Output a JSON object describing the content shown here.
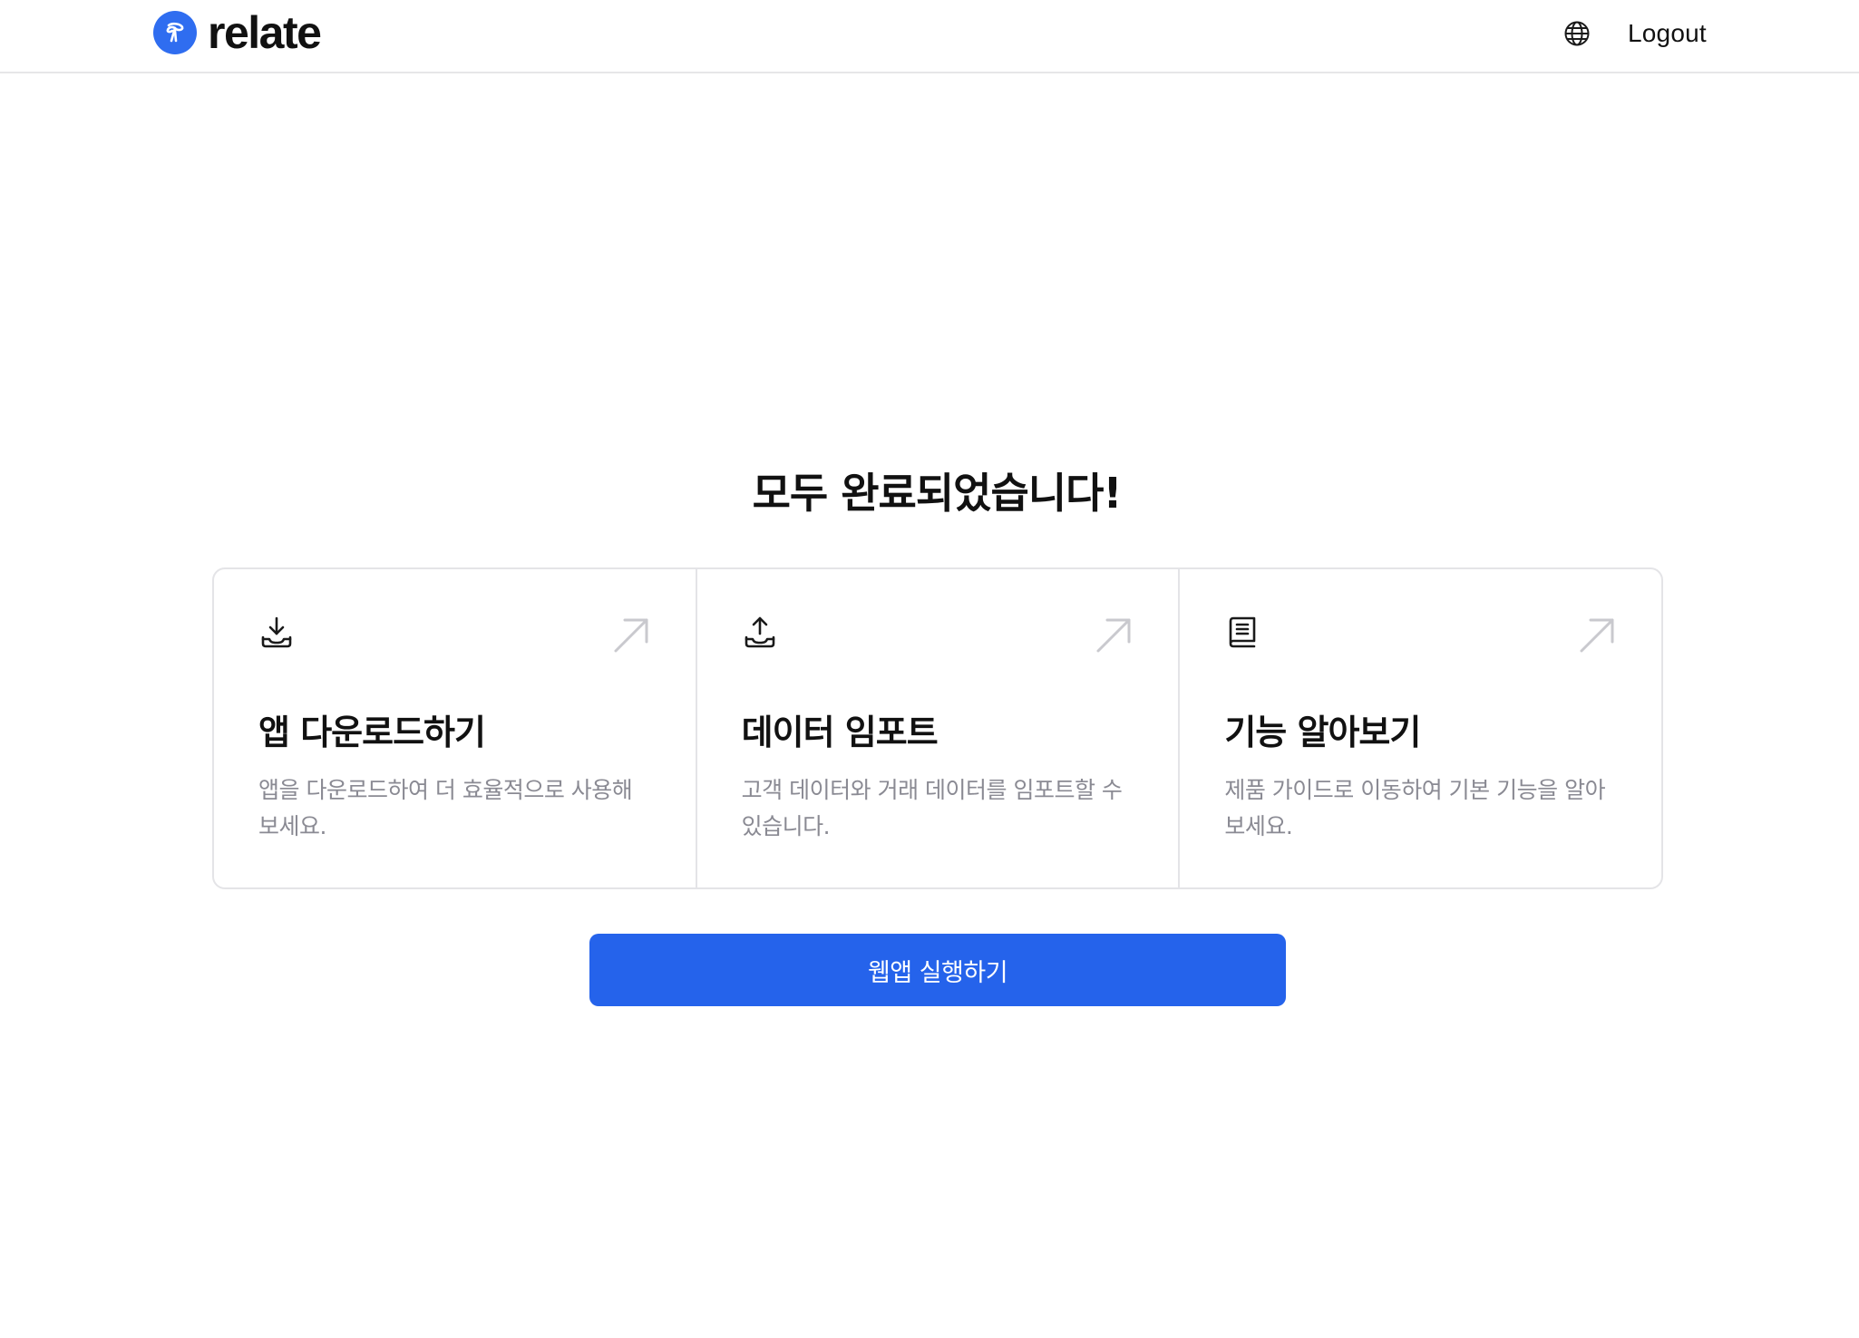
{
  "header": {
    "logo_text": "relate",
    "logout_label": "Logout",
    "icons": {
      "logo": "relate-logo-icon",
      "language": "globe-icon"
    },
    "brand_color": "#2f6df0"
  },
  "main": {
    "title": "모두 완료되었습니다!",
    "cards": [
      {
        "icon": "download-icon",
        "title": "앱 다운로드하기",
        "description": "앱을 다운로드하여 더 효율적으로 사용해보세요."
      },
      {
        "icon": "upload-icon",
        "title": "데이터 임포트",
        "description": "고객 데이터와 거래 데이터를 임포트할 수 있습니다."
      },
      {
        "icon": "book-icon",
        "title": "기능 알아보기",
        "description": "제품 가이드로 이동하여 기본 기능을 알아보세요."
      }
    ],
    "cta_label": "웹앱 실행하기",
    "cta_color": "#2563eb"
  }
}
